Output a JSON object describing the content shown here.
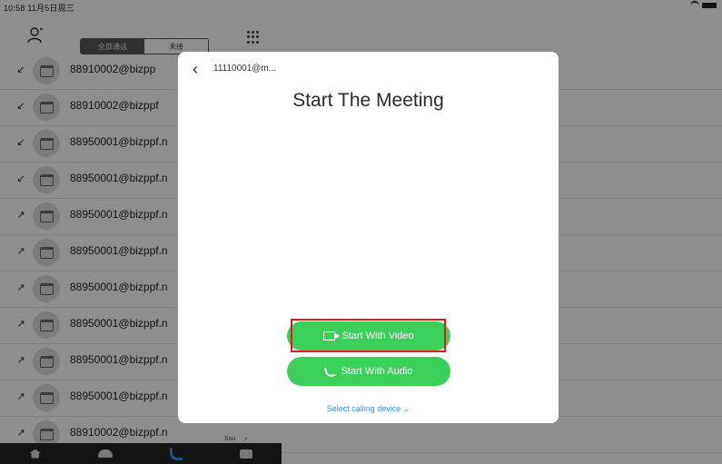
{
  "status_bar": {
    "time": "10:58 11月5日周三"
  },
  "toolbar": {
    "segment": [
      "全部通话",
      "未接"
    ]
  },
  "call_list": {
    "rows": [
      {
        "direction": "↙",
        "name": "88910002@bizpp",
        "meta_label": "",
        "meta_time": ""
      },
      {
        "direction": "↙",
        "name": "88910002@bizppf",
        "meta_label": "",
        "meta_time": ""
      },
      {
        "direction": "↙",
        "name": "88950001@bizppf.n",
        "meta_label": "",
        "meta_time": ""
      },
      {
        "direction": "↙",
        "name": "88950001@bizppf.n",
        "meta_label": "",
        "meta_time": ""
      },
      {
        "direction": "↗",
        "name": "88950001@bizppf.n",
        "meta_label": "",
        "meta_time": ""
      },
      {
        "direction": "↗",
        "name": "88950001@bizppf.n",
        "meta_label": "",
        "meta_time": ""
      },
      {
        "direction": "↗",
        "name": "88950001@bizppf.n",
        "meta_label": "",
        "meta_time": ""
      },
      {
        "direction": "↗",
        "name": "88950001@bizppf.n",
        "meta_label": "",
        "meta_time": ""
      },
      {
        "direction": "↗",
        "name": "88950001@bizppf.n",
        "meta_label": "",
        "meta_time": ""
      },
      {
        "direction": "↗",
        "name": "88950001@bizppf.n",
        "meta_label": "",
        "meta_time": ""
      },
      {
        "direction": "↗",
        "name": "88910002@bizppf.n",
        "meta_label": "Ssu",
        "meta_time": ""
      }
    ]
  },
  "modal": {
    "header_title": "11110001@m...",
    "title": "Start The Meeting",
    "start_video_label": "Start With Video",
    "start_audio_label": "Start With Audio",
    "select_device_label": "Select calling device ⌄"
  },
  "colors": {
    "accent_green": "#3ccf5a",
    "link_blue": "#2f8de4",
    "highlight_red": "#e0191f"
  }
}
